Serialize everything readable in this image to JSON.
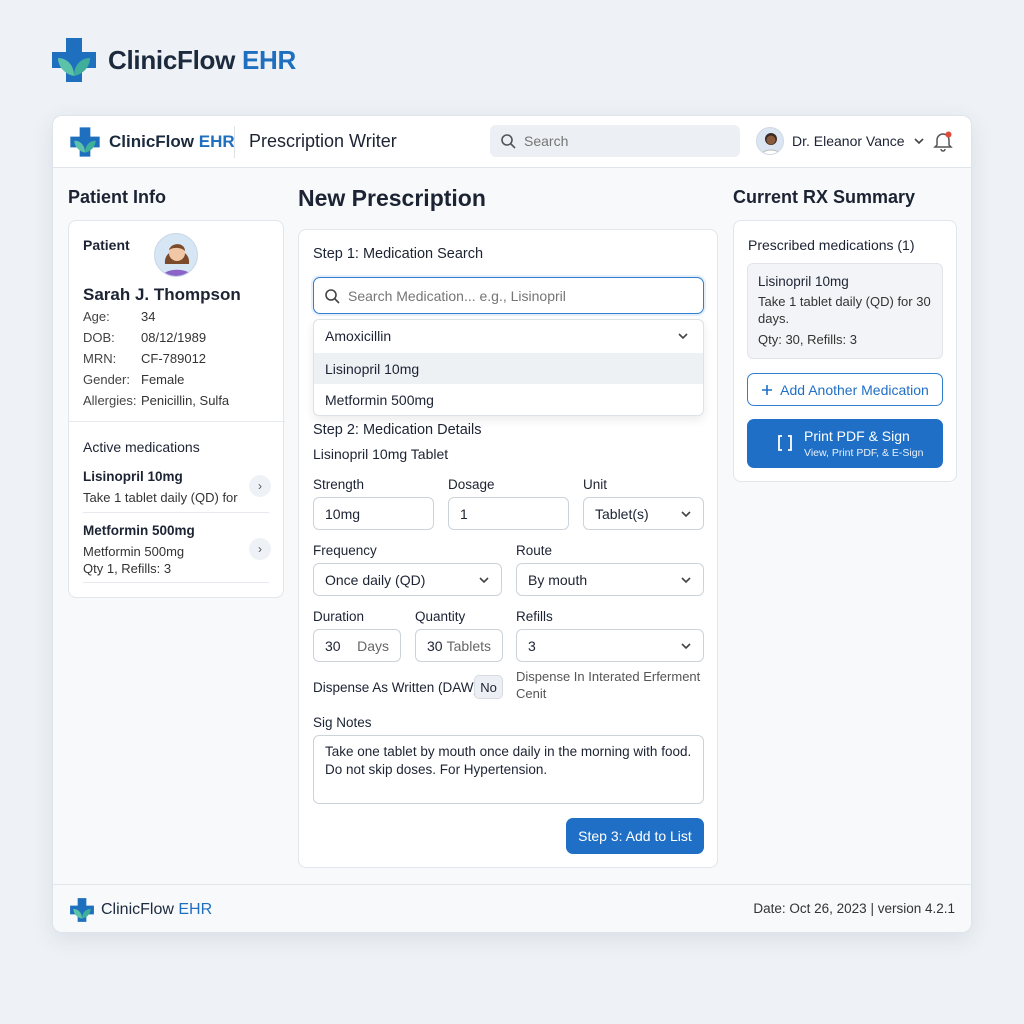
{
  "brand": {
    "name": "ClinicFlow",
    "accent": "EHR"
  },
  "topbar": {
    "page_title": "Prescription Writer",
    "search_placeholder": "Search",
    "user_name": "Dr. Eleanor Vance"
  },
  "patient": {
    "section_title": "Patient Info",
    "label": "Patient",
    "name": "Sarah J. Thompson",
    "fields": [
      {
        "key": "Age:",
        "value": "34"
      },
      {
        "key": "DOB:",
        "value": "08/12/1989"
      },
      {
        "key": "MRN:",
        "value": "CF-789012"
      },
      {
        "key": "Gender:",
        "value": "Female"
      },
      {
        "key": "Allergies:",
        "value": "Penicillin, Sulfa"
      }
    ],
    "active_title": "Active medications",
    "active": [
      {
        "title": "Lisinopril 10mg",
        "line1": "Take 1 tablet daily (QD) for",
        "line2": ""
      },
      {
        "title": "Metformin 500mg",
        "line1": "Metformin 500mg",
        "line2": "Qty 1, Refills: 3"
      }
    ]
  },
  "rx": {
    "section_title": "New Prescription",
    "step1": "Step 1: Medication Search",
    "search_placeholder": "Search Medication... e.g., Lisinopril",
    "options": [
      "Amoxicillin",
      "Lisinopril 10mg",
      "Metformin 500mg"
    ],
    "step2": "Step 2: Medication Details",
    "selected_med": "Lisinopril 10mg Tablet",
    "strength_label": "Strength",
    "strength": "10mg",
    "dosage_label": "Dosage",
    "dosage": "1",
    "unit_label": "Unit",
    "unit": "Tablet(s)",
    "frequency_label": "Frequency",
    "frequency": "Once daily (QD)",
    "route_label": "Route",
    "route": "By mouth",
    "duration_label": "Duration",
    "duration": "30",
    "duration_unit": "Days",
    "quantity_label": "Quantity",
    "quantity": "30",
    "quantity_unit": "Tablets",
    "refills_label": "Refills",
    "refills": "3",
    "daw_label": "Dispense As Written (DAW)",
    "daw_value": "No",
    "dispense_note": "Dispense In Interated Erferment Cenit",
    "sig_label": "Sig Notes",
    "sig_text": "Take one tablet by mouth once daily in the morning with food. Do not skip doses. For Hypertension.",
    "add_button": "Step 3: Add to List"
  },
  "summary": {
    "section_title": "Current RX Summary",
    "prescribed_title": "Prescribed medications (1)",
    "item": {
      "title": "Lisinopril 10mg",
      "desc": "Take 1 tablet daily (QD) for 30 days.",
      "qty": "Qty: 30, Refills: 3"
    },
    "add_another": "Add Another Medication",
    "print_title": "Print PDF & Sign",
    "print_sub": "View, Print PDF, & E-Sign"
  },
  "footer": {
    "meta": "Date: Oct 26, 2023 | version 4.2.1"
  },
  "colors": {
    "primary": "#1f6fc6",
    "accent_text": "#1f6fbf",
    "brand_teal": "#3fae9a"
  }
}
